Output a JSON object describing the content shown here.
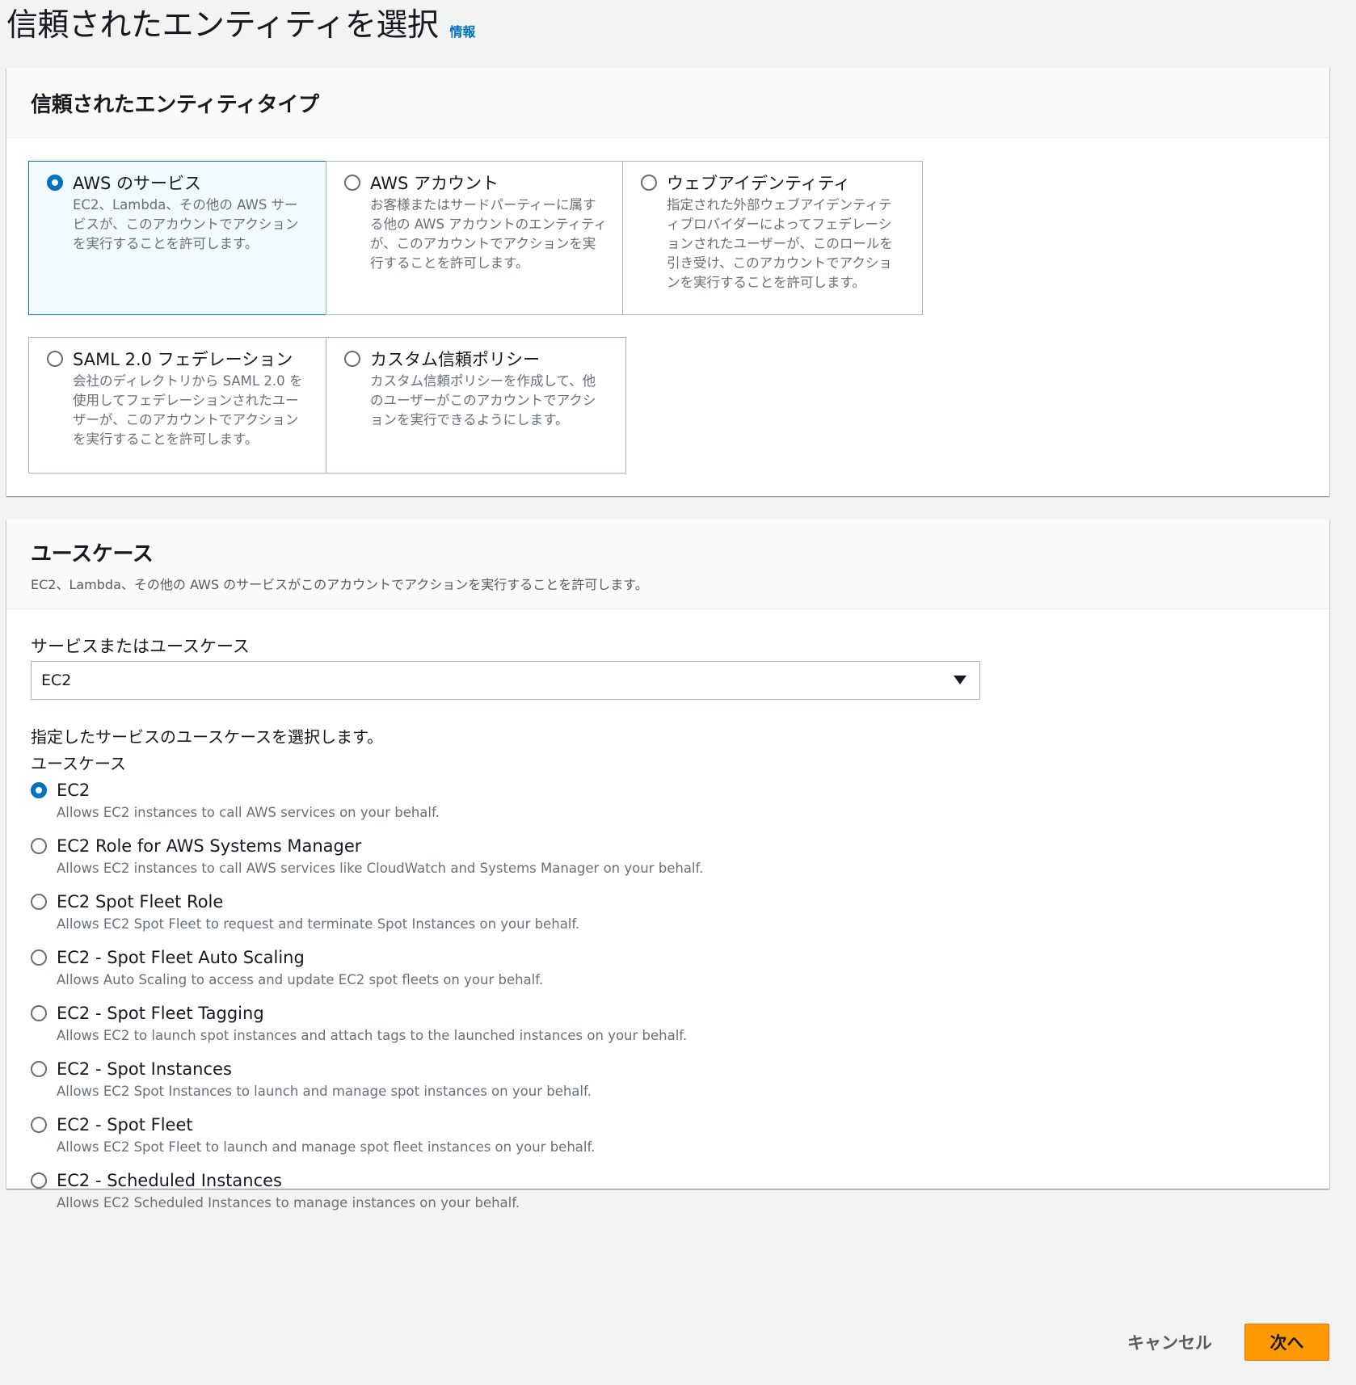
{
  "page": {
    "title": "信頼されたエンティティを選択",
    "info_link": "情報"
  },
  "entity_type": {
    "title": "信頼されたエンティティタイプ",
    "selected": "aws_service",
    "options": [
      {
        "id": "aws_service",
        "label": "AWS のサービス",
        "description": "EC2、Lambda、その他の AWS サービスが、このアカウントでアクションを実行することを許可します。",
        "checked": true
      },
      {
        "id": "aws_account",
        "label": "AWS アカウント",
        "description": "お客様またはサードパーティーに属する他の AWS アカウントのエンティティが、このアカウントでアクションを実行することを許可します。",
        "checked": false
      },
      {
        "id": "web_identity",
        "label": "ウェブアイデンティティ",
        "description": "指定された外部ウェブアイデンティティプロバイダーによってフェデレーションされたユーザーが、このロールを引き受け、このアカウントでアクションを実行することを許可します。",
        "checked": false
      },
      {
        "id": "saml",
        "label": "SAML 2.0 フェデレーション",
        "description": "会社のディレクトリから SAML 2.0 を使用してフェデレーションされたユーザーが、このアカウントでアクションを実行することを許可します。",
        "checked": false
      },
      {
        "id": "custom_trust",
        "label": "カスタム信頼ポリシー",
        "description": "カスタム信頼ポリシーを作成して、他のユーザーがこのアカウントでアクションを実行できるようにします。",
        "checked": false
      }
    ]
  },
  "use_case": {
    "title": "ユースケース",
    "description": "EC2、Lambda、その他の AWS のサービスがこのアカウントでアクションを実行することを許可します。",
    "service_label": "サービスまたはユースケース",
    "service_value": "EC2",
    "hint": "指定したサービスのユースケースを選択します。",
    "group_label": "ユースケース",
    "options": [
      {
        "label": "EC2",
        "description": "Allows EC2 instances to call AWS services on your behalf.",
        "checked": true
      },
      {
        "label": "EC2 Role for AWS Systems Manager",
        "description": "Allows EC2 instances to call AWS services like CloudWatch and Systems Manager on your behalf.",
        "checked": false
      },
      {
        "label": "EC2 Spot Fleet Role",
        "description": "Allows EC2 Spot Fleet to request and terminate Spot Instances on your behalf.",
        "checked": false
      },
      {
        "label": "EC2 - Spot Fleet Auto Scaling",
        "description": "Allows Auto Scaling to access and update EC2 spot fleets on your behalf.",
        "checked": false
      },
      {
        "label": "EC2 - Spot Fleet Tagging",
        "description": "Allows EC2 to launch spot instances and attach tags to the launched instances on your behalf.",
        "checked": false
      },
      {
        "label": "EC2 - Spot Instances",
        "description": "Allows EC2 Spot Instances to launch and manage spot instances on your behalf.",
        "checked": false
      },
      {
        "label": "EC2 - Spot Fleet",
        "description": "Allows EC2 Spot Fleet to launch and manage spot fleet instances on your behalf.",
        "checked": false
      },
      {
        "label": "EC2 - Scheduled Instances",
        "description": "Allows EC2 Scheduled Instances to manage instances on your behalf.",
        "checked": false
      }
    ]
  },
  "actions": {
    "cancel": "キャンセル",
    "next": "次へ"
  },
  "colors": {
    "accent": "#0073bb",
    "primary_button": "#ff9900",
    "background": "#f2f3f3"
  },
  "icons": {
    "dropdown": "caret-down-icon"
  }
}
